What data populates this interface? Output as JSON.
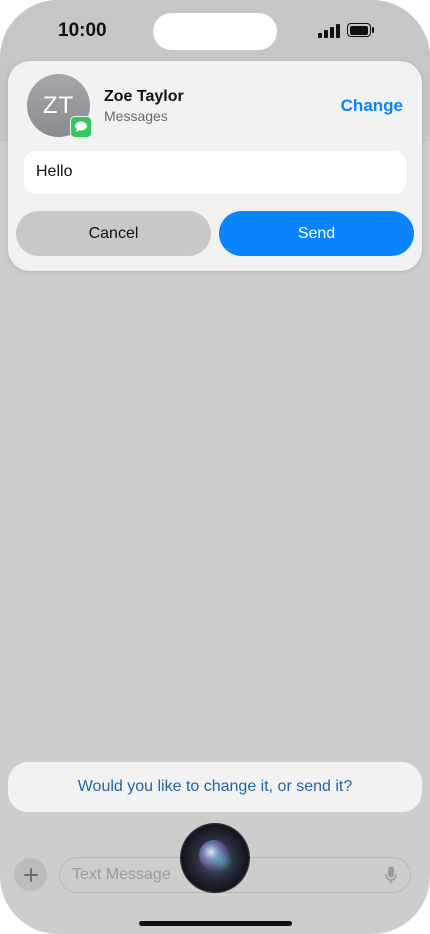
{
  "status_bar": {
    "time": "10:00"
  },
  "contact": {
    "initials": "ZT",
    "name": "Zoe Taylor",
    "app": "Messages",
    "change_label": "Change"
  },
  "message": {
    "text": "Hello"
  },
  "buttons": {
    "cancel_label": "Cancel",
    "send_label": "Send"
  },
  "siri": {
    "prompt": "Would you like to change it, or send it?"
  },
  "composer": {
    "placeholder": "Text Message"
  },
  "icons": {
    "messages_badge": "messages-app-icon",
    "plus": "plus-icon",
    "mic": "microphone-icon",
    "siri": "siri-orb-icon"
  },
  "colors": {
    "accent": "#0a84ff",
    "messages_green": "#34c759",
    "siri_text": "#2366a8"
  }
}
